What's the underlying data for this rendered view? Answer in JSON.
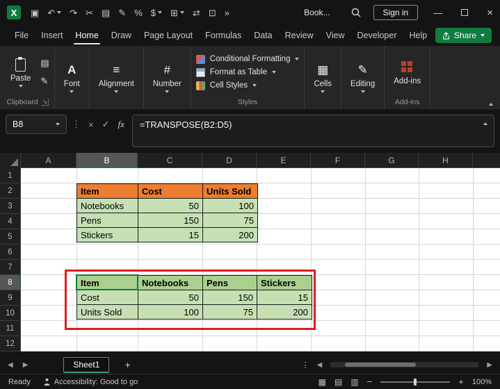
{
  "colors": {
    "accent_green": "#107C41",
    "orange_header": "#ED7D31",
    "green_header": "#A9D08E",
    "green_cell": "#C6E0B4",
    "annotation_red": "#E11D1D"
  },
  "icons": {
    "excel_logo": "X",
    "save": "▣",
    "undo": "↶",
    "redo": "↷",
    "cut": "✂",
    "copy": "▤",
    "format_painter": "✎",
    "percent": "%",
    "currency": "$",
    "borders": "⊞",
    "merge_center": "⇄",
    "screenshot": "⊡",
    "more_commands": "»",
    "minimize": "—",
    "close": "×",
    "font_a": "A",
    "alignment_lines": "≡",
    "number_sign": "#",
    "cells_grid": "▦",
    "editing_pencil": "✎",
    "dialog_launcher": "↘",
    "more_dots": "⋮",
    "cancel": "×",
    "check": "✓",
    "left_arrow": "◀",
    "right_arrow": "▶",
    "add_sheet": "+",
    "view_normal": "▦",
    "view_layout": "▤",
    "view_break": "▥",
    "minus": "−",
    "plus": "+"
  },
  "title_bar": {
    "workbook_name": "Book...",
    "sign_in_label": "Sign in"
  },
  "menu": {
    "tabs": [
      {
        "label": "File"
      },
      {
        "label": "Insert"
      },
      {
        "label": "Home"
      },
      {
        "label": "Draw"
      },
      {
        "label": "Page Layout"
      },
      {
        "label": "Formulas"
      },
      {
        "label": "Data"
      },
      {
        "label": "Review"
      },
      {
        "label": "View"
      },
      {
        "label": "Developer"
      },
      {
        "label": "Help"
      }
    ],
    "active_tab": "Home",
    "share_label": "Share"
  },
  "ribbon": {
    "paste_label": "Paste",
    "font_label": "Font",
    "alignment_label": "Alignment",
    "number_label": "Number",
    "conditional_formatting_label": "Conditional Formatting",
    "format_as_table_label": "Format as Table",
    "cell_styles_label": "Cell Styles",
    "cells_label": "Cells",
    "editing_label": "Editing",
    "addins_label": "Add-ins",
    "group_labels": {
      "clipboard": "Clipboard",
      "styles": "Styles",
      "addins": "Add-ins"
    }
  },
  "formula_bar": {
    "name_box": "B8",
    "fx_label": "fx",
    "formula": "=TRANSPOSE(B2:D5)"
  },
  "sheet": {
    "columns": [
      "A",
      "B",
      "C",
      "D",
      "E",
      "F",
      "G",
      "H"
    ],
    "rows": [
      "1",
      "2",
      "3",
      "4",
      "5",
      "6",
      "7",
      "8",
      "9",
      "10",
      "11",
      "12"
    ],
    "selected_column": "B",
    "selected_row": "8",
    "active_cell": "B8",
    "table1": {
      "header": [
        "Item",
        "Cost",
        "Units Sold"
      ],
      "rows": [
        [
          "Notebooks",
          "50",
          "100"
        ],
        [
          "Pens",
          "150",
          "75"
        ],
        [
          "Stickers",
          "15",
          "200"
        ]
      ]
    },
    "table2": {
      "header": [
        "Item",
        "Notebooks",
        "Pens",
        "Stickers"
      ],
      "rows": [
        [
          "Cost",
          "50",
          "150",
          "15"
        ],
        [
          "Units Sold",
          "100",
          "75",
          "200"
        ]
      ]
    }
  },
  "tab_bar": {
    "sheet_name": "Sheet1"
  },
  "status_bar": {
    "mode": "Ready",
    "accessibility": "Accessibility: Good to go",
    "zoom": "100%"
  }
}
